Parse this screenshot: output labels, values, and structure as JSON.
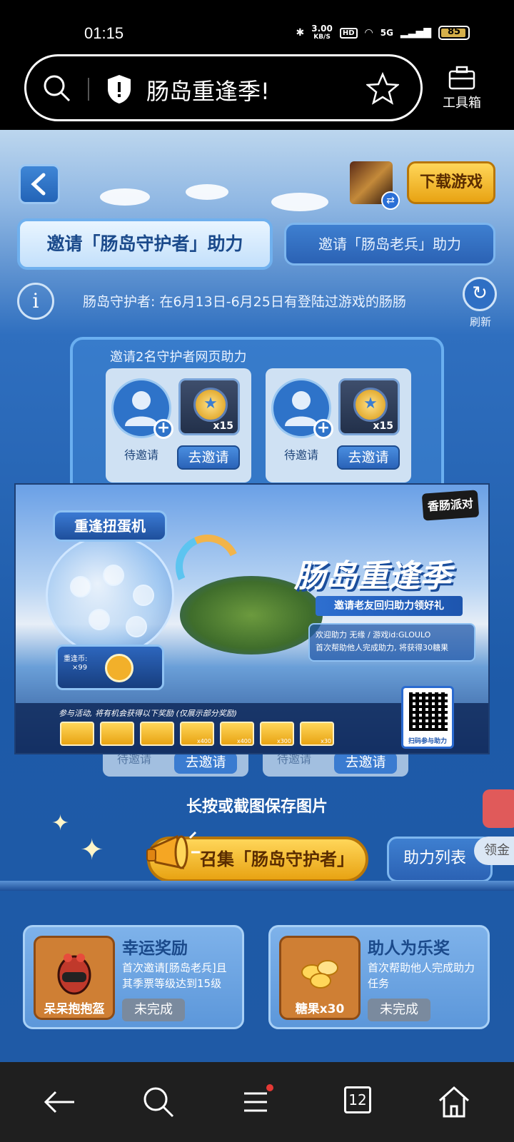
{
  "status_bar": {
    "time": "01:15",
    "net_speed": "3.00",
    "net_unit": "KB/S",
    "hd": "HD",
    "signal": "5G",
    "battery": "85"
  },
  "browser": {
    "url_title": "肠岛重逢季!",
    "toolbox_label": "工具箱"
  },
  "header": {
    "download_label": "下载游戏"
  },
  "tabs": [
    {
      "label": "邀请「肠岛守护者」助力",
      "active": true
    },
    {
      "label": "邀请「肠岛老兵」助力",
      "active": false
    }
  ],
  "info": {
    "text": "肠岛守护者: 在6月13日-6月25日有登陆过游戏的肠肠",
    "refresh_label": "刷新"
  },
  "invite_panel": {
    "heading": "邀请2名守护者网页助力",
    "slots": [
      {
        "status": "待邀请",
        "reward_qty": "x15",
        "button": "去邀请"
      },
      {
        "status": "待邀请",
        "reward_qty": "x15",
        "button": "去邀请"
      }
    ]
  },
  "poster": {
    "logo": "香肠派对",
    "machine_title": "重逢扭蛋机",
    "machine_coin": "重逢币:",
    "machine_coin_qty": "×99",
    "title": "肠岛重逢季",
    "subtitle": "邀请老友回归助力领好礼",
    "welcome_line1": "欢迎助力 无缘 / 游戏id:GLOULO",
    "welcome_line2": "首次帮助他人完成助力, 将获得30糖果",
    "participate_note": "参与活动, 将有机会获得以下奖励 (仅展示部分奖励)",
    "reward_quantities": [
      "",
      "",
      "",
      "x400",
      "x400",
      "x300",
      "x30"
    ],
    "qr_label": "扫码参与助力"
  },
  "under_slots": [
    {
      "status": "待邀请",
      "button": "去邀请"
    },
    {
      "status": "待邀请",
      "button": "去邀请"
    }
  ],
  "save_hint": "长按或截图保存图片",
  "actions": {
    "gather_label": "召集「肠岛守护者」",
    "help_list_label": "助力列表",
    "side_tab": "领金"
  },
  "cards": [
    {
      "thumb_caption": "呆呆抱抱盔",
      "title": "幸运奖励",
      "desc": "首次邀请[肠岛老兵]且其季票等级达到15级",
      "status": "未完成"
    },
    {
      "thumb_caption": "糖果x30",
      "title": "助人为乐奖",
      "desc": "首次帮助他人完成助力任务",
      "status": "未完成"
    }
  ],
  "nav": {
    "tab_count": "12"
  },
  "colors": {
    "accent_gold": "#e8a313",
    "panel_blue": "#2b62b4",
    "title_blue": "#1b4a8b"
  }
}
